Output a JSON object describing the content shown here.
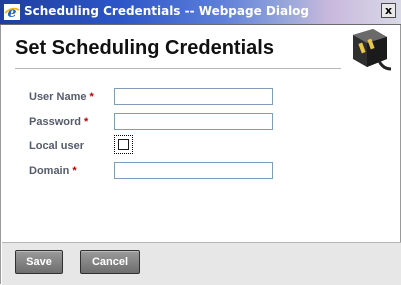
{
  "window": {
    "title": "Scheduling Credentials -- Webpage Dialog",
    "close_glyph": "x",
    "icon": "ie-icon"
  },
  "page": {
    "title": "Set Scheduling Credentials",
    "icon": "power-plug-icon"
  },
  "form": {
    "required_marker": "*",
    "fields": [
      {
        "label": "User Name",
        "required": true,
        "type": "text",
        "value": ""
      },
      {
        "label": "Password",
        "required": true,
        "type": "password",
        "value": ""
      },
      {
        "label": "Local user",
        "required": false,
        "type": "checkbox",
        "checked": false
      },
      {
        "label": "Domain",
        "required": true,
        "type": "text",
        "value": ""
      }
    ]
  },
  "footer": {
    "save_label": "Save",
    "cancel_label": "Cancel"
  },
  "colors": {
    "label": "#555b6b",
    "required": "#c00000",
    "button": "#7a7a7a"
  }
}
